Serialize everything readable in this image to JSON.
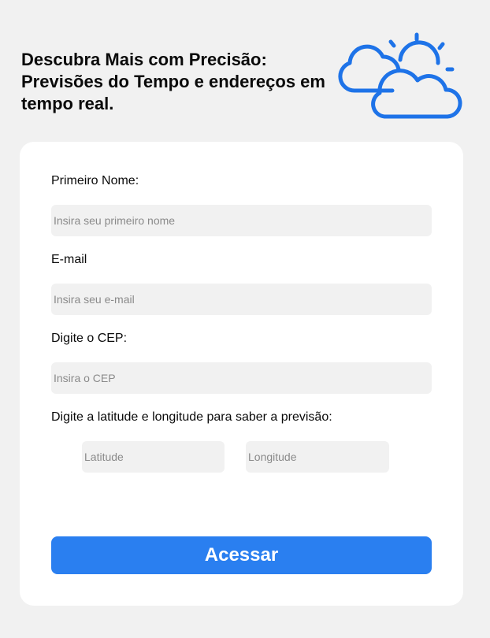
{
  "header": {
    "title": "Descubra Mais com Precisão: Previsões do Tempo e endereços em tempo real.",
    "icon": "cloud-sun-icon",
    "icon_color": "#1e73e8"
  },
  "form": {
    "first_name": {
      "label": "Primeiro Nome:",
      "placeholder": "Insira seu primeiro nome",
      "value": ""
    },
    "email": {
      "label": "E-mail",
      "placeholder": "Insira seu e-mail",
      "value": ""
    },
    "cep": {
      "label": "Digite o CEP:",
      "placeholder": "Insira o CEP",
      "value": ""
    },
    "coords": {
      "label": "Digite a latitude e longitude para saber a previsão:",
      "latitude_placeholder": "Latitude",
      "longitude_placeholder": "Longitude"
    },
    "submit_label": "Acessar"
  },
  "colors": {
    "background": "#f1f1f1",
    "card": "#ffffff",
    "input_bg": "#f1f1f1",
    "accent": "#2a7ff0"
  }
}
